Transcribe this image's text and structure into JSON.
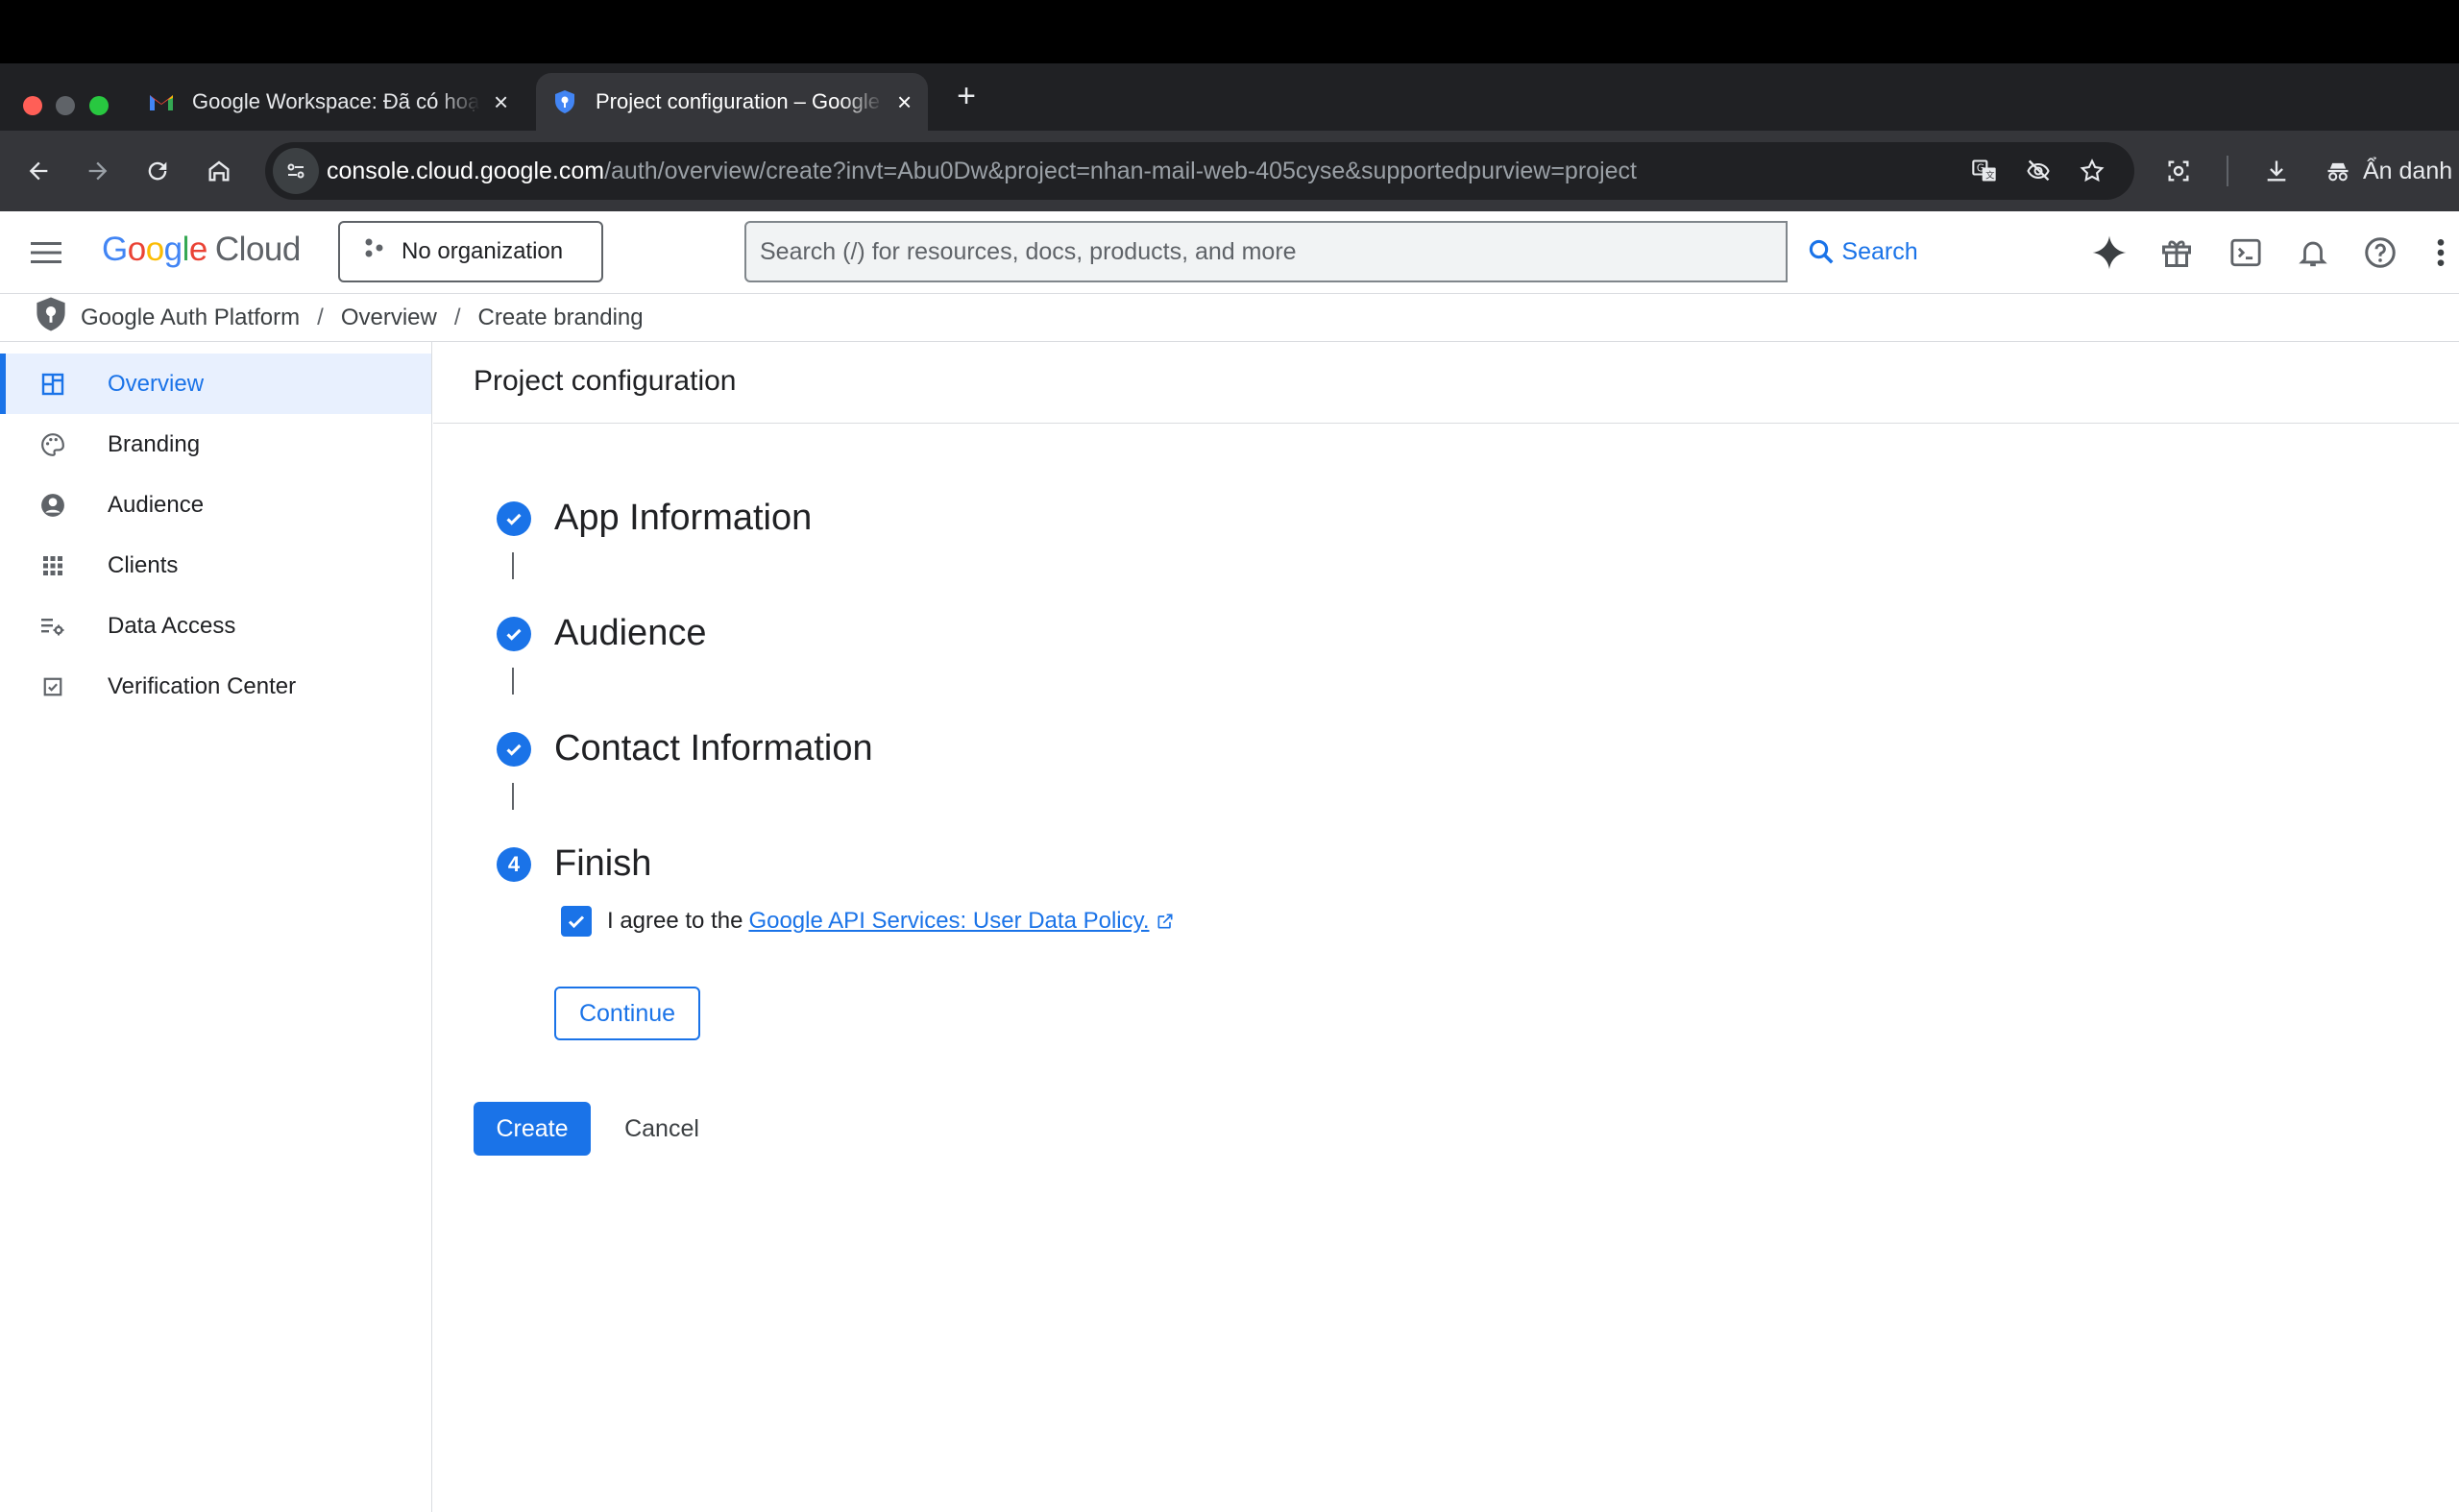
{
  "browser": {
    "tabs": [
      {
        "title": "Google Workspace: Đã có hoạt",
        "favicon": "gmail-icon",
        "active": false
      },
      {
        "title": "Project configuration – Google",
        "favicon": "shield-icon",
        "active": true
      }
    ],
    "url_host": "console.cloud.google.com",
    "url_path": "/auth/overview/create?invt=Abu0Dw&project=nhan-mail-web-405cyse&supportedpurview=project",
    "profile_label": "Ẩn danh"
  },
  "header": {
    "logo_letters": [
      "G",
      "o",
      "o",
      "g",
      "l",
      "e"
    ],
    "logo_suffix": "Cloud",
    "org_label": "No organization",
    "search_placeholder": "Search (/) for resources, docs, products, and more",
    "search_button": "Search",
    "icons": [
      "gemini-icon",
      "gift-icon",
      "cloud-shell-icon",
      "notifications-icon",
      "help-icon",
      "more-vert-icon"
    ]
  },
  "breadcrumb": [
    "Google Auth Platform",
    "Overview",
    "Create branding"
  ],
  "sidebar": {
    "items": [
      {
        "label": "Overview",
        "icon": "dashboard-icon",
        "active": true
      },
      {
        "label": "Branding",
        "icon": "palette-icon",
        "active": false
      },
      {
        "label": "Audience",
        "icon": "account-circle-icon",
        "active": false
      },
      {
        "label": "Clients",
        "icon": "apps-grid-icon",
        "active": false
      },
      {
        "label": "Data Access",
        "icon": "data-settings-icon",
        "active": false
      },
      {
        "label": "Verification Center",
        "icon": "verification-icon",
        "active": false
      }
    ]
  },
  "main": {
    "title": "Project configuration",
    "steps": [
      {
        "label": "App Information",
        "status": "complete"
      },
      {
        "label": "Audience",
        "status": "complete"
      },
      {
        "label": "Contact Information",
        "status": "complete"
      },
      {
        "label": "Finish",
        "status": "current",
        "number": "4"
      }
    ],
    "agree_prefix": "I agree to the",
    "agree_link": "Google API Services: User Data Policy.",
    "agree_checked": true,
    "continue_label": "Continue",
    "create_label": "Create",
    "cancel_label": "Cancel"
  },
  "colors": {
    "accent": "#1a73e8",
    "active_nav_bg": "#e8f0fe",
    "chrome_dark": "#202124",
    "toolbar": "#35363a"
  }
}
